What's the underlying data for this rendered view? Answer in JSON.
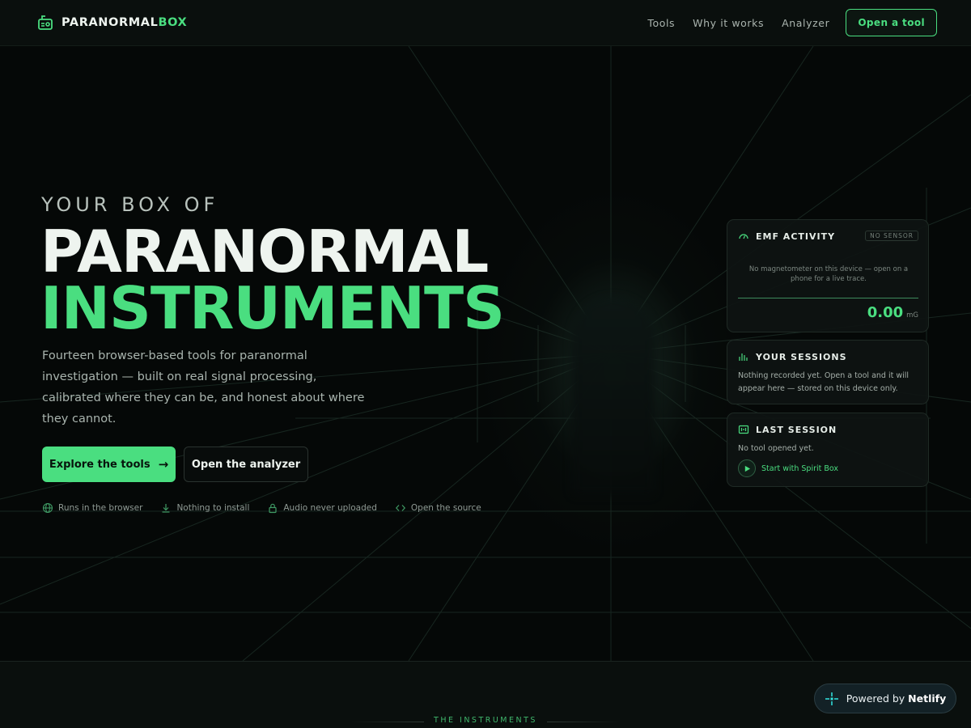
{
  "nav": {
    "brand_main": "PARANORMAL",
    "brand_accent": "BOX",
    "links": [
      "Tools",
      "Why it works",
      "Analyzer"
    ],
    "cta": "Open a tool"
  },
  "hero": {
    "eyebrow": "YOUR BOX OF",
    "title_line1": "PARANORMAL",
    "title_line2": "INSTRUMENTS",
    "lede": "Fourteen browser-based tools for paranormal investigation — built on real signal processing, calibrated where they can be, and honest about where they cannot.",
    "primary_button": "Explore the tools",
    "primary_arrow": "→",
    "secondary_button": "Open the analyzer",
    "features": [
      {
        "icon": "globe-icon",
        "label": "Runs in the browser"
      },
      {
        "icon": "download-icon",
        "label": "Nothing to install"
      },
      {
        "icon": "lock-icon",
        "label": "Audio never uploaded"
      },
      {
        "icon": "code-icon",
        "label": "Open the source"
      }
    ]
  },
  "panels": {
    "emf": {
      "icon": "gauge-icon",
      "title": "EMF ACTIVITY",
      "badge": "NO SENSOR",
      "message": "No magnetometer on this device — open on a phone for a live trace.",
      "value": "0.00",
      "unit": "mG"
    },
    "sessions": {
      "icon": "bars-icon",
      "title": "YOUR SESSIONS",
      "text": "Nothing recorded yet. Open a tool and it will appear here — stored on this device only."
    },
    "last": {
      "icon": "radio-icon",
      "title": "LAST SESSION",
      "text": "No tool opened yet.",
      "link": "Start with Spirit Box"
    }
  },
  "lower": {
    "section_label": "THE INSTRUMENTS"
  },
  "netlify": {
    "prefix": "Powered by",
    "brand": "Netlify"
  },
  "colors": {
    "accent": "#4ade80",
    "background": "#050807",
    "panel": "#0e1412"
  }
}
